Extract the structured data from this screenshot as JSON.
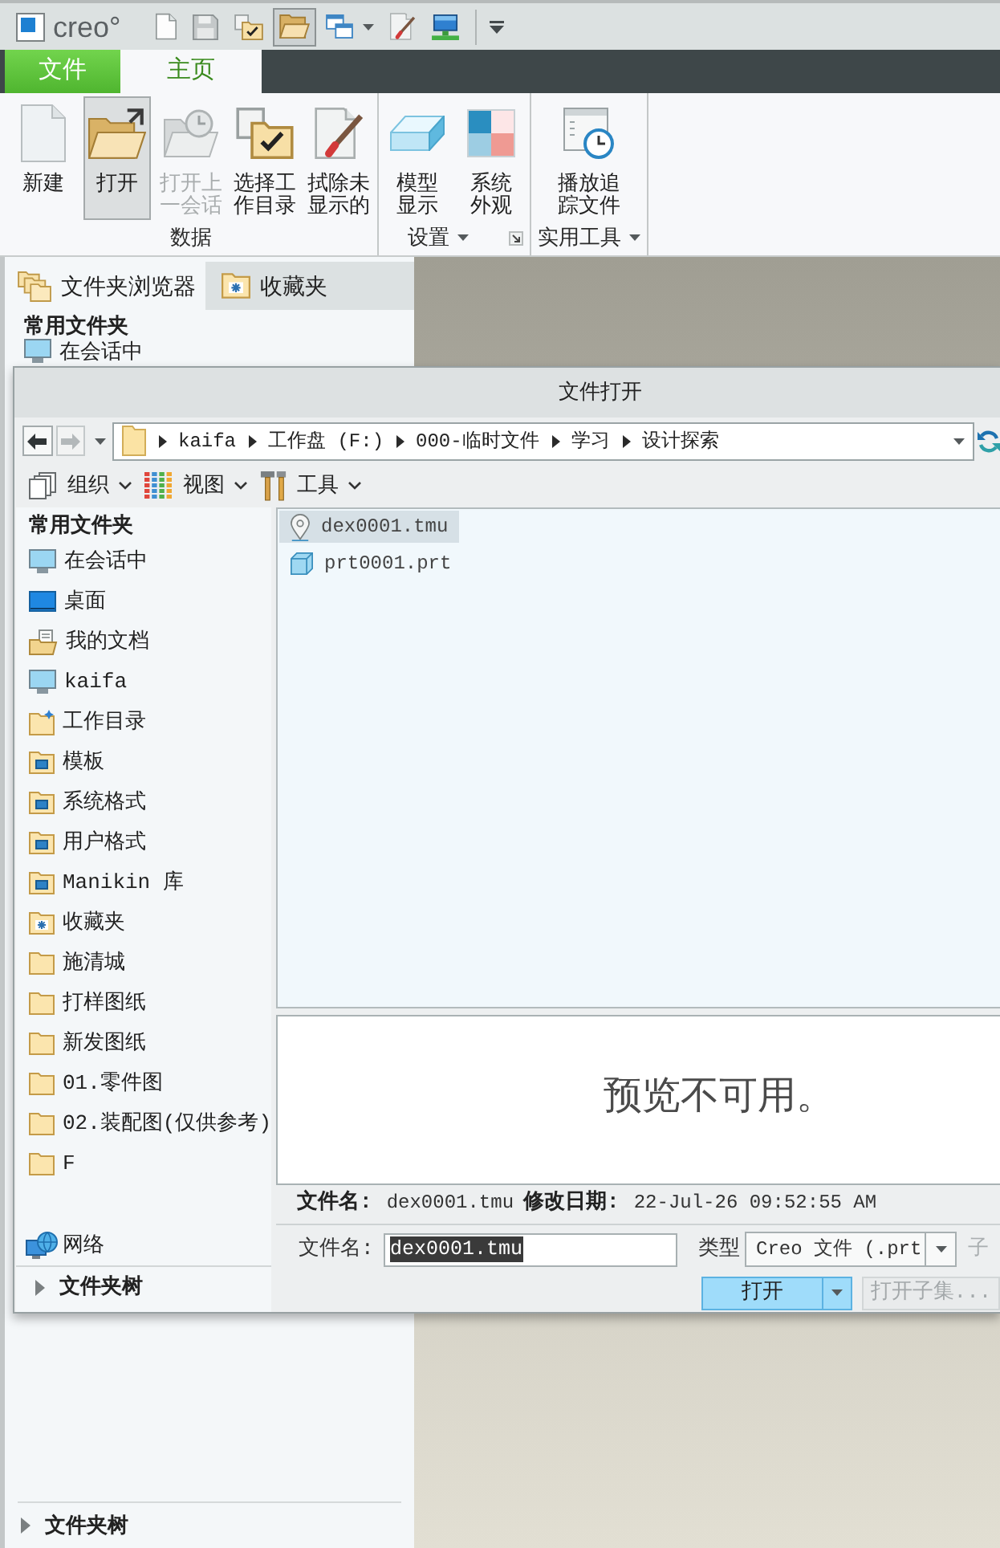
{
  "logo": "creo°",
  "quick_access": [
    {
      "kind": "new",
      "selected": false,
      "menu": false
    },
    {
      "kind": "save",
      "selected": false,
      "menu": false
    },
    {
      "kind": "workdir",
      "selected": false,
      "menu": false
    },
    {
      "kind": "open",
      "selected": true,
      "menu": false
    },
    {
      "kind": "windows",
      "selected": false,
      "menu": true
    },
    {
      "kind": "erase",
      "selected": false,
      "menu": false
    },
    {
      "kind": "monitor",
      "selected": false,
      "menu": false
    }
  ],
  "ribbon": {
    "tabs": [
      {
        "label": "文件",
        "kind": "file",
        "selected": false
      },
      {
        "label": "主页",
        "kind": "page",
        "selected": true
      }
    ],
    "groups": [
      {
        "label": "数据",
        "menu": false,
        "launcher": false,
        "buttons": [
          {
            "label": "新建",
            "kind": "new",
            "selected": false,
            "disabled": false
          },
          {
            "label": "打开",
            "kind": "open",
            "selected": true,
            "disabled": false
          },
          {
            "label": "打开上一会话",
            "kind": "session",
            "selected": false,
            "disabled": true
          },
          {
            "label": "选择工作目录",
            "kind": "workdir",
            "selected": false,
            "disabled": false
          },
          {
            "label": "拭除未显示的",
            "kind": "erase",
            "selected": false,
            "disabled": false
          }
        ]
      },
      {
        "label": "设置",
        "menu": true,
        "launcher": true,
        "buttons": [
          {
            "label": "模型显示",
            "kind": "display",
            "selected": false,
            "disabled": false
          },
          {
            "label": "系统外观",
            "kind": "appearance",
            "selected": false,
            "disabled": false
          }
        ]
      },
      {
        "label": "实用工具",
        "menu": true,
        "launcher": false,
        "buttons": [
          {
            "label": "播放追踪文件",
            "kind": "trail",
            "selected": false,
            "disabled": false
          }
        ]
      }
    ]
  },
  "left_panel": {
    "tabs": [
      {
        "label": "文件夹浏览器",
        "kind": "folders",
        "selected": true
      },
      {
        "label": "收藏夹",
        "kind": "favorites",
        "selected": false
      }
    ],
    "heading": "常用文件夹",
    "items": [
      {
        "label": "在会话中",
        "kind": "session"
      }
    ],
    "folder_tree": {
      "label": "文件夹树",
      "expanded": false
    }
  },
  "dialog": {
    "title": "文件打开",
    "nav": [
      {
        "kind": "back",
        "disabled": false
      },
      {
        "kind": "forward",
        "disabled": true
      }
    ],
    "path": [
      "kaifa",
      "工作盘 (F:)",
      "000-临时文件",
      "学习",
      "设计探索"
    ],
    "toolbar": [
      {
        "label": "组织",
        "kind": "organize"
      },
      {
        "label": "视图",
        "kind": "view"
      },
      {
        "label": "工具",
        "kind": "tools"
      }
    ],
    "sidebar": {
      "heading": "常用文件夹",
      "items": [
        {
          "label": "在会话中",
          "kind": "session"
        },
        {
          "label": "桌面",
          "kind": "desktop"
        },
        {
          "label": "我的文档",
          "kind": "documents"
        },
        {
          "label": "kaifa",
          "kind": "computer"
        },
        {
          "label": "工作目录",
          "kind": "workdir"
        },
        {
          "label": "模板",
          "kind": "system"
        },
        {
          "label": "系统格式",
          "kind": "system"
        },
        {
          "label": "用户格式",
          "kind": "system"
        },
        {
          "label": "Manikin 库",
          "kind": "system"
        },
        {
          "label": "收藏夹",
          "kind": "favorites"
        },
        {
          "label": "施清城",
          "kind": "folder"
        },
        {
          "label": "打样图纸",
          "kind": "folder"
        },
        {
          "label": "新发图纸",
          "kind": "folder"
        },
        {
          "label": "01.零件图",
          "kind": "folder"
        },
        {
          "label": "02.装配图(仅供参考)",
          "kind": "folder"
        },
        {
          "label": "F",
          "kind": "folder"
        }
      ],
      "bottom_items": [
        {
          "label": "网络",
          "kind": "network"
        }
      ],
      "folder_tree": {
        "label": "文件夹树",
        "expanded": false
      }
    },
    "files": [
      {
        "name": "dex0001.tmu",
        "kind": "trail",
        "selected": true
      },
      {
        "name": "prt0001.prt",
        "kind": "part",
        "selected": false
      }
    ],
    "preview": "预览不可用。",
    "details": [
      {
        "label": "文件名:",
        "value": "dex0001.tmu"
      },
      {
        "label": "修改日期:",
        "value": "22-Jul-26 09:52:55 AM"
      }
    ],
    "filename": {
      "label": "文件名:",
      "value": "dex0001.tmu",
      "highlighted": true
    },
    "type": {
      "label": "类型",
      "value": "Creo 文件 (.prt"
    },
    "subtype": {
      "label": "子",
      "disabled": true
    },
    "buttons": [
      {
        "label": "打开",
        "kind": "primary",
        "disabled": false,
        "menu": true
      },
      {
        "label": "打开子集...",
        "kind": "secondary",
        "disabled": true,
        "menu": false
      }
    ]
  }
}
